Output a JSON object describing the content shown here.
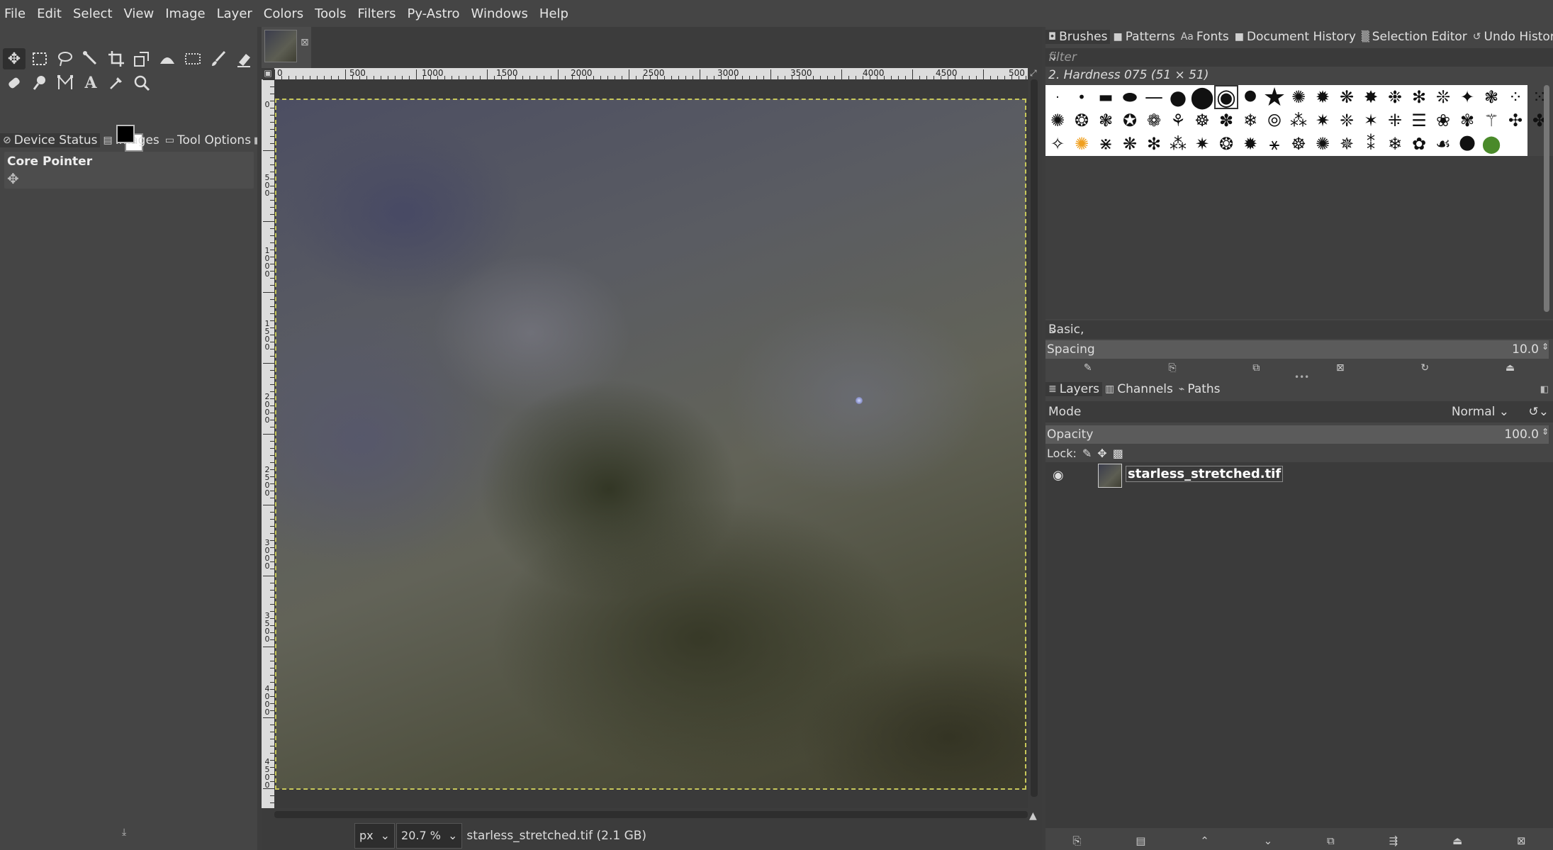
{
  "menubar": {
    "items": [
      "File",
      "Edit",
      "Select",
      "View",
      "Image",
      "Layer",
      "Colors",
      "Tools",
      "Filters",
      "Py-Astro",
      "Windows",
      "Help"
    ]
  },
  "left_dock": {
    "tabs": [
      {
        "label": "Device Status",
        "icon": "device-status-icon"
      },
      {
        "label": "Images",
        "icon": "images-icon"
      },
      {
        "label": "Tool Options",
        "icon": "tool-options-icon"
      }
    ],
    "device_status": {
      "core_pointer": "Core Pointer"
    }
  },
  "image_tab": {
    "close": "⊠"
  },
  "rulers": {
    "horizontal": [
      "0",
      "500",
      "1000",
      "1500",
      "2000",
      "2500",
      "3000",
      "3500",
      "4000",
      "4500",
      "500"
    ],
    "vertical": [
      "0",
      "500",
      "1000",
      "1500",
      "2000",
      "2500",
      "3000",
      "3500",
      "4000",
      "4500"
    ]
  },
  "status": {
    "unit": "px",
    "zoom": "20.7 %",
    "text": "starless_stretched.tif (2.1 GB)"
  },
  "right_dock": {
    "tabs_top": [
      {
        "label": "Brushes",
        "icon": "brushes-icon"
      },
      {
        "label": "Patterns",
        "icon": "patterns-icon"
      },
      {
        "label": "Fonts",
        "icon": "fonts-icon"
      },
      {
        "label": "Document History",
        "icon": "document-history-icon"
      },
      {
        "label": "Selection Editor",
        "icon": "selection-editor-icon"
      },
      {
        "label": "Undo History",
        "icon": "undo-history-icon"
      }
    ],
    "filter_placeholder": "filter",
    "brush_name": "2. Hardness 075 (51 × 51)",
    "tag": "Basic,",
    "spacing_label": "Spacing",
    "spacing_value": "10.0",
    "tabs_bottom": [
      {
        "label": "Layers",
        "icon": "layers-icon"
      },
      {
        "label": "Channels",
        "icon": "channels-icon"
      },
      {
        "label": "Paths",
        "icon": "paths-icon"
      }
    ],
    "mode_label": "Mode",
    "mode_value": "Normal",
    "opacity_label": "Opacity",
    "opacity_value": "100.0",
    "lock_label": "Lock:",
    "layer_name": "starless_stretched.tif"
  }
}
